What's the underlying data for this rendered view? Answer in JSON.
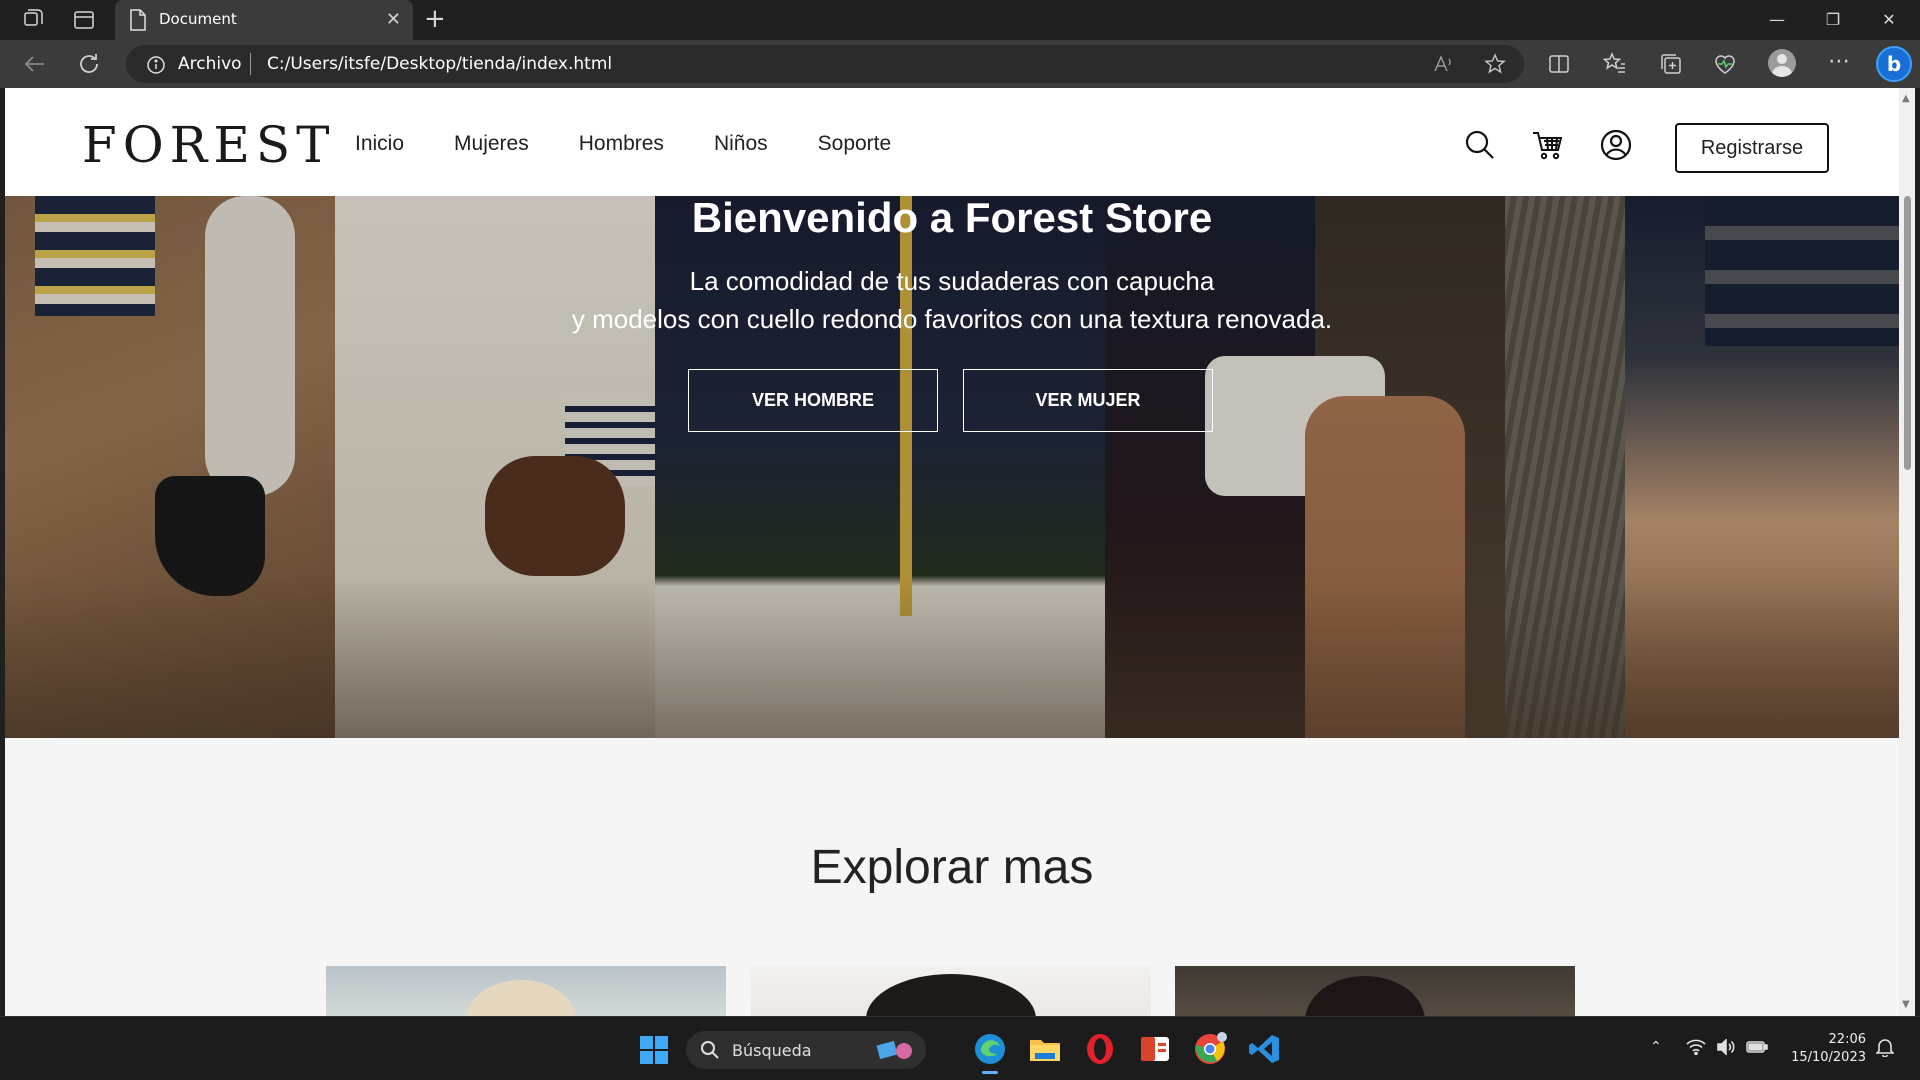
{
  "browser": {
    "tab_title": "Document",
    "address_label": "Archivo",
    "url": "C:/Users/itsfe/Desktop/tienda/index.html"
  },
  "site": {
    "logo": "FOREST",
    "nav": [
      "Inicio",
      "Mujeres",
      "Hombres",
      "Niños",
      "Soporte"
    ],
    "register": "Registrarse"
  },
  "hero": {
    "title": "Bienvenido a Forest Store",
    "subtitle_line1": "La comodidad de tus sudaderas con capucha",
    "subtitle_line2": "y modelos con cuello redondo favoritos con una textura renovada.",
    "btn_men": "VER HOMBRE",
    "btn_women": "VER MUJER"
  },
  "explore": {
    "title": "Explorar mas"
  },
  "taskbar": {
    "search_placeholder": "Búsqueda",
    "time": "22:06",
    "date": "15/10/2023"
  }
}
